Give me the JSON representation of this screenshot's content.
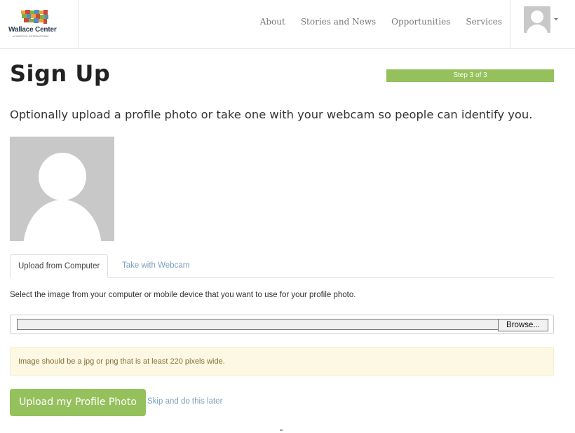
{
  "header": {
    "brand_name": "Wallace Center",
    "brand_sub": "at WINROCK INTERNATIONAL",
    "nav": [
      {
        "label": "About"
      },
      {
        "label": "Stories and News"
      },
      {
        "label": "Opportunities"
      },
      {
        "label": "Services"
      }
    ],
    "user_icon": "user-avatar-icon",
    "menu_icon": "caret-down-icon"
  },
  "page": {
    "title": "Sign Up",
    "step_label": "Step 3 of 3",
    "step_progress": 1.0,
    "intro": "Optionally upload a profile photo or take one with your webcam so people can identify you."
  },
  "tabs": [
    {
      "label": "Upload from Computer",
      "active": true
    },
    {
      "label": "Take with Webcam",
      "active": false
    }
  ],
  "upload": {
    "instructions": "Select the image from your computer or mobile device that you want to use for your profile photo.",
    "browse_label": "Browse...",
    "file_value": "",
    "warning": "Image should be a jpg or png that is at least 220 pixels wide.",
    "submit_label": "Upload my Profile Photo",
    "skip_label": "Skip and do this later"
  },
  "colors": {
    "accent": "#94c15c",
    "link": "#7a9fbf",
    "warning_bg": "#fcf8e3",
    "warning_text": "#8a6d3b"
  }
}
